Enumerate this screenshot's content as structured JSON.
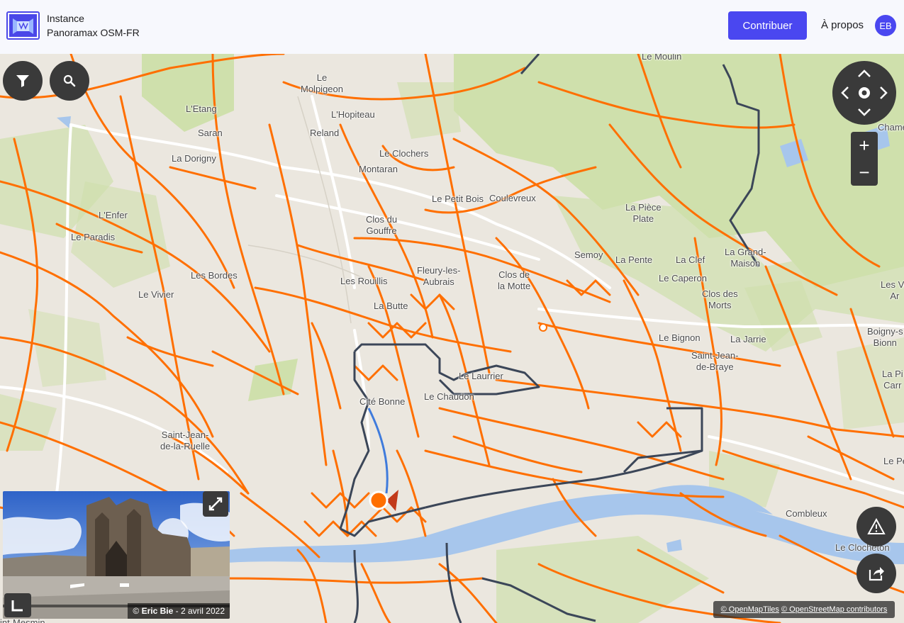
{
  "header": {
    "instance_label": "Instance",
    "instance_name": "Panoramax OSM-FR",
    "contribute_label": "Contribuer",
    "about_label": "À propos",
    "user_initials": "EB"
  },
  "map": {
    "labels": [
      {
        "id": "le-moulin",
        "text": "Le Moulin"
      },
      {
        "id": "le-molpigeon",
        "text": "Le\nMolpigeon"
      },
      {
        "id": "l-etang",
        "text": "L'Etang"
      },
      {
        "id": "l-hopiteau",
        "text": "L'Hopiteau"
      },
      {
        "id": "saran",
        "text": "Saran"
      },
      {
        "id": "reland",
        "text": "Reland"
      },
      {
        "id": "chame",
        "text": "Chame"
      },
      {
        "id": "la-dorigny",
        "text": "La Dorigny"
      },
      {
        "id": "le-clochers",
        "text": "Le Clochers"
      },
      {
        "id": "montaran",
        "text": "Montaran"
      },
      {
        "id": "le-petit-bois",
        "text": "Le Petit Bois"
      },
      {
        "id": "coulevreux",
        "text": "Coulevreux"
      },
      {
        "id": "la-piece-plate",
        "text": "La Pièce\nPlate"
      },
      {
        "id": "l-enfer",
        "text": "L'Enfer"
      },
      {
        "id": "clos-du-gouffre",
        "text": "Clos du\nGouffre"
      },
      {
        "id": "le-paradis",
        "text": "Le Paradis"
      },
      {
        "id": "semoy",
        "text": "Semoy"
      },
      {
        "id": "la-pente",
        "text": "La Pente"
      },
      {
        "id": "la-clef",
        "text": "La Clef"
      },
      {
        "id": "la-grand-maison",
        "text": "La Grand-\nMaison"
      },
      {
        "id": "fleury",
        "text": "Fleury-les-\nAubrais"
      },
      {
        "id": "clos-de-la-motte",
        "text": "Clos de\nla Motte"
      },
      {
        "id": "les-bordes",
        "text": "Les Bordes"
      },
      {
        "id": "les-rouillis",
        "text": "Les Rouillis"
      },
      {
        "id": "le-caperon",
        "text": "Le Caperon"
      },
      {
        "id": "les-ve",
        "text": "Les Ve\nAr"
      },
      {
        "id": "le-vivier",
        "text": "Le Vivier"
      },
      {
        "id": "clos-des-morts",
        "text": "Clos des\nMorts"
      },
      {
        "id": "la-butte",
        "text": "La Butte"
      },
      {
        "id": "le-bignon",
        "text": "Le Bignon"
      },
      {
        "id": "la-jarrie",
        "text": "La Jarrie"
      },
      {
        "id": "boigny",
        "text": "Boigny-s\nBionn"
      },
      {
        "id": "saint-jean-de-braye",
        "text": "Saint-Jean-\nde-Braye"
      },
      {
        "id": "le-laurrier",
        "text": "Le Laurrier"
      },
      {
        "id": "la-pi-carr",
        "text": "La Pi\nCarr"
      },
      {
        "id": "le-chaudon",
        "text": "Le Chaudon"
      },
      {
        "id": "cite-bonne",
        "text": "Cité Bonne"
      },
      {
        "id": "saint-jean-de-la-ruelle",
        "text": "Saint-Jean-\nde-la-Ruelle"
      },
      {
        "id": "le-pe",
        "text": "Le Pe"
      },
      {
        "id": "combleux",
        "text": "Combleux"
      },
      {
        "id": "le-clocheton",
        "text": "Le Clocheton"
      },
      {
        "id": "saint-mesmin",
        "text": "int-Mesmin"
      }
    ]
  },
  "photo": {
    "credit_prefix": "© ",
    "author": "Eric Bie",
    "date": " - 2 avril 2022"
  },
  "attribution": {
    "tiles": "© OpenMapTiles",
    "osm": "© OpenStreetMap contributors"
  },
  "icons": {
    "filter": "filter-icon",
    "search": "search-icon",
    "report": "warning-icon",
    "share": "share-icon",
    "expand": "expand-icon",
    "minimize": "corner-icon"
  },
  "colors": {
    "accent": "#4a47f0",
    "sequence": "#ff6f00",
    "selected_sequence": "#3b4658",
    "water": "#a7c6ec",
    "forest": "#cfe0ac"
  }
}
